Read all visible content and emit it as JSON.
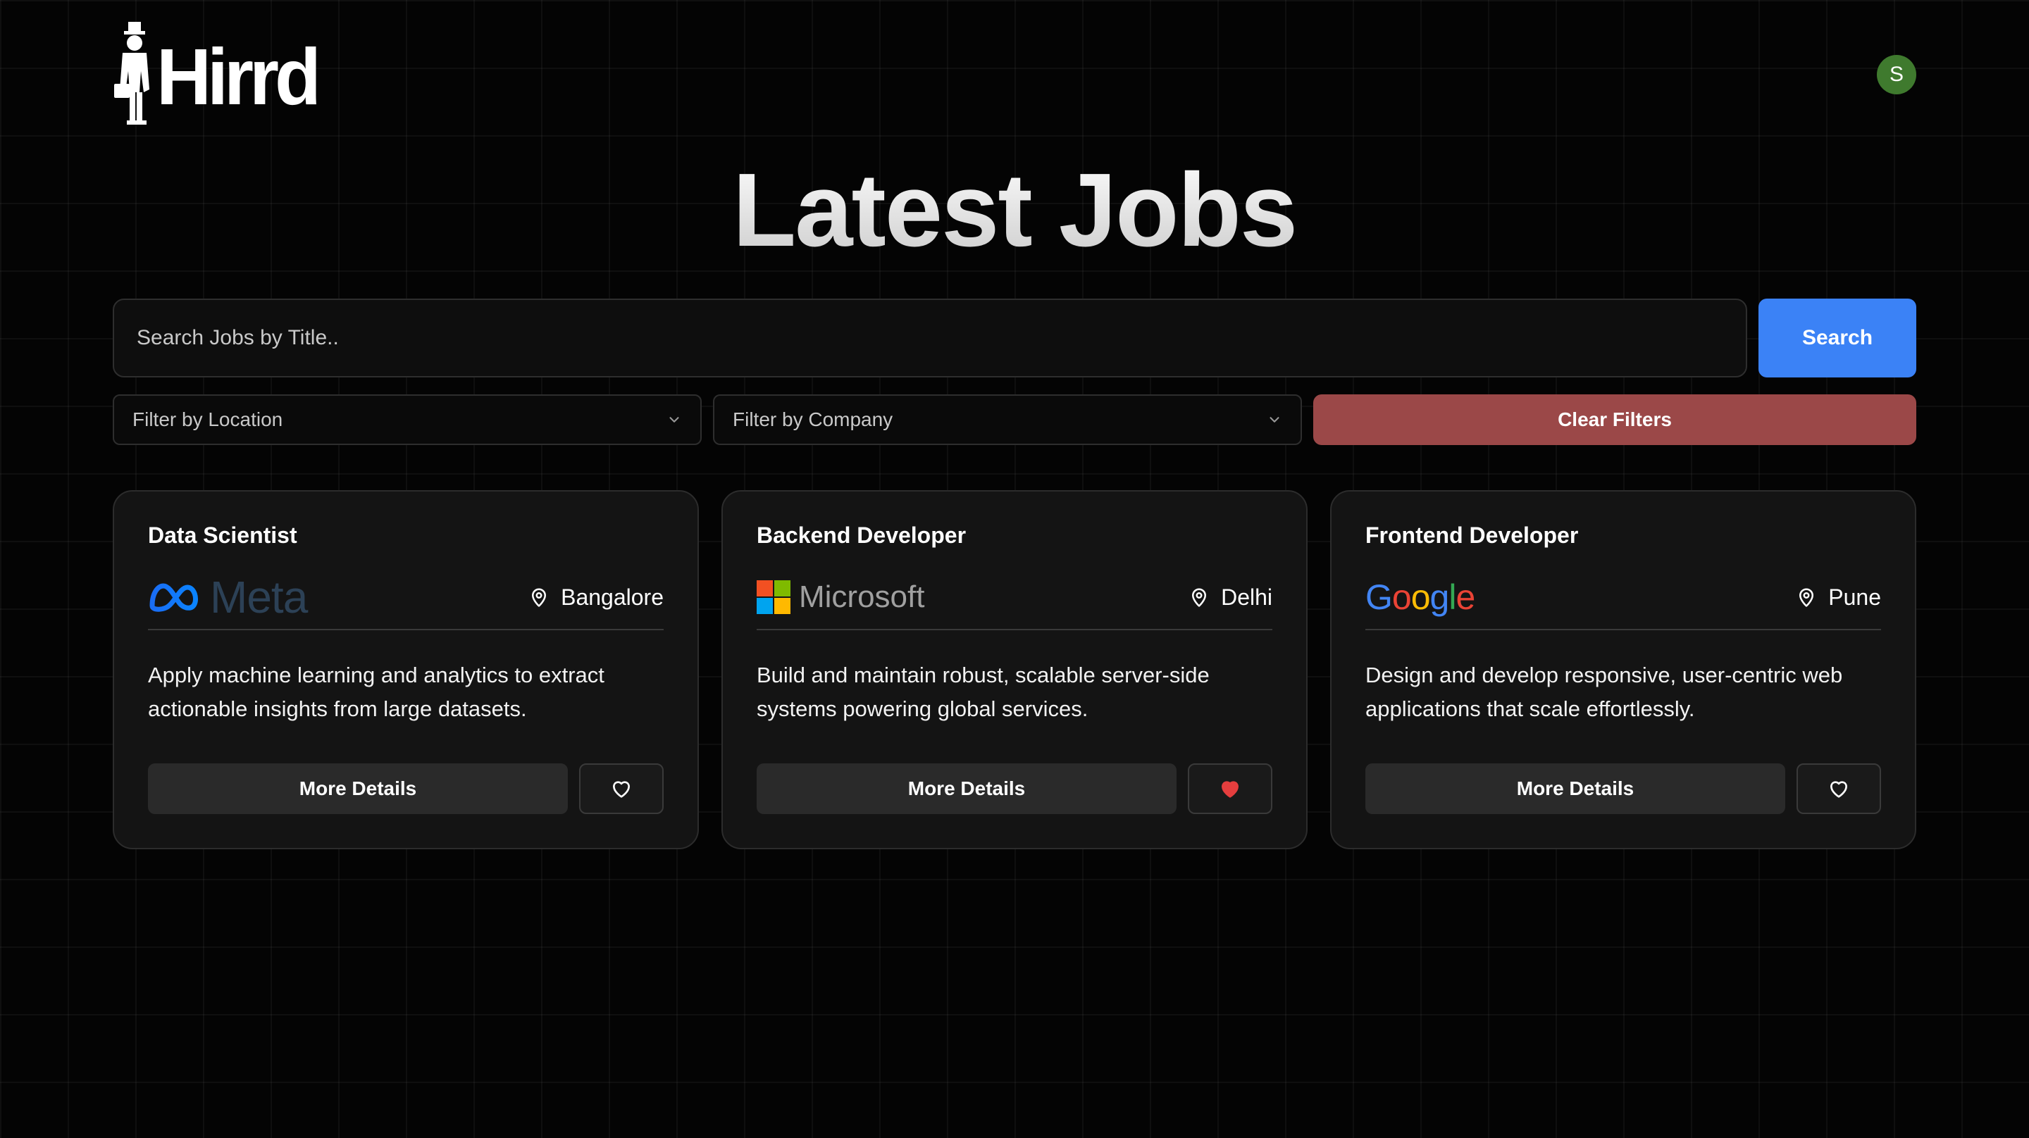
{
  "brand": {
    "name": "Hirrd"
  },
  "user": {
    "avatar_initial": "S",
    "avatar_color": "#3f7a2e"
  },
  "headline": "Latest Jobs",
  "search": {
    "placeholder": "Search Jobs by Title..",
    "button_label": "Search"
  },
  "filters": {
    "location_placeholder": "Filter by Location",
    "company_placeholder": "Filter by Company",
    "clear_label": "Clear Filters"
  },
  "colors": {
    "accent": "#3b82f6",
    "danger": "#9b4848",
    "favorite_active": "#e53e3e"
  },
  "jobs": [
    {
      "title": "Data Scientist",
      "company": "Meta",
      "company_logo": "meta-logo",
      "location": "Bangalore",
      "description": "Apply machine learning and analytics to extract actionable insights from large datasets.",
      "details_label": "More Details",
      "favorited": false
    },
    {
      "title": "Backend Developer",
      "company": "Microsoft",
      "company_logo": "microsoft-logo",
      "location": "Delhi",
      "description": "Build and maintain robust, scalable server-side systems powering global services.",
      "details_label": "More Details",
      "favorited": true
    },
    {
      "title": "Frontend Developer",
      "company": "Google",
      "company_logo": "google-logo",
      "location": "Pune",
      "description": "Design and develop responsive, user-centric web applications that scale effortlessly.",
      "details_label": "More Details",
      "favorited": false
    }
  ]
}
